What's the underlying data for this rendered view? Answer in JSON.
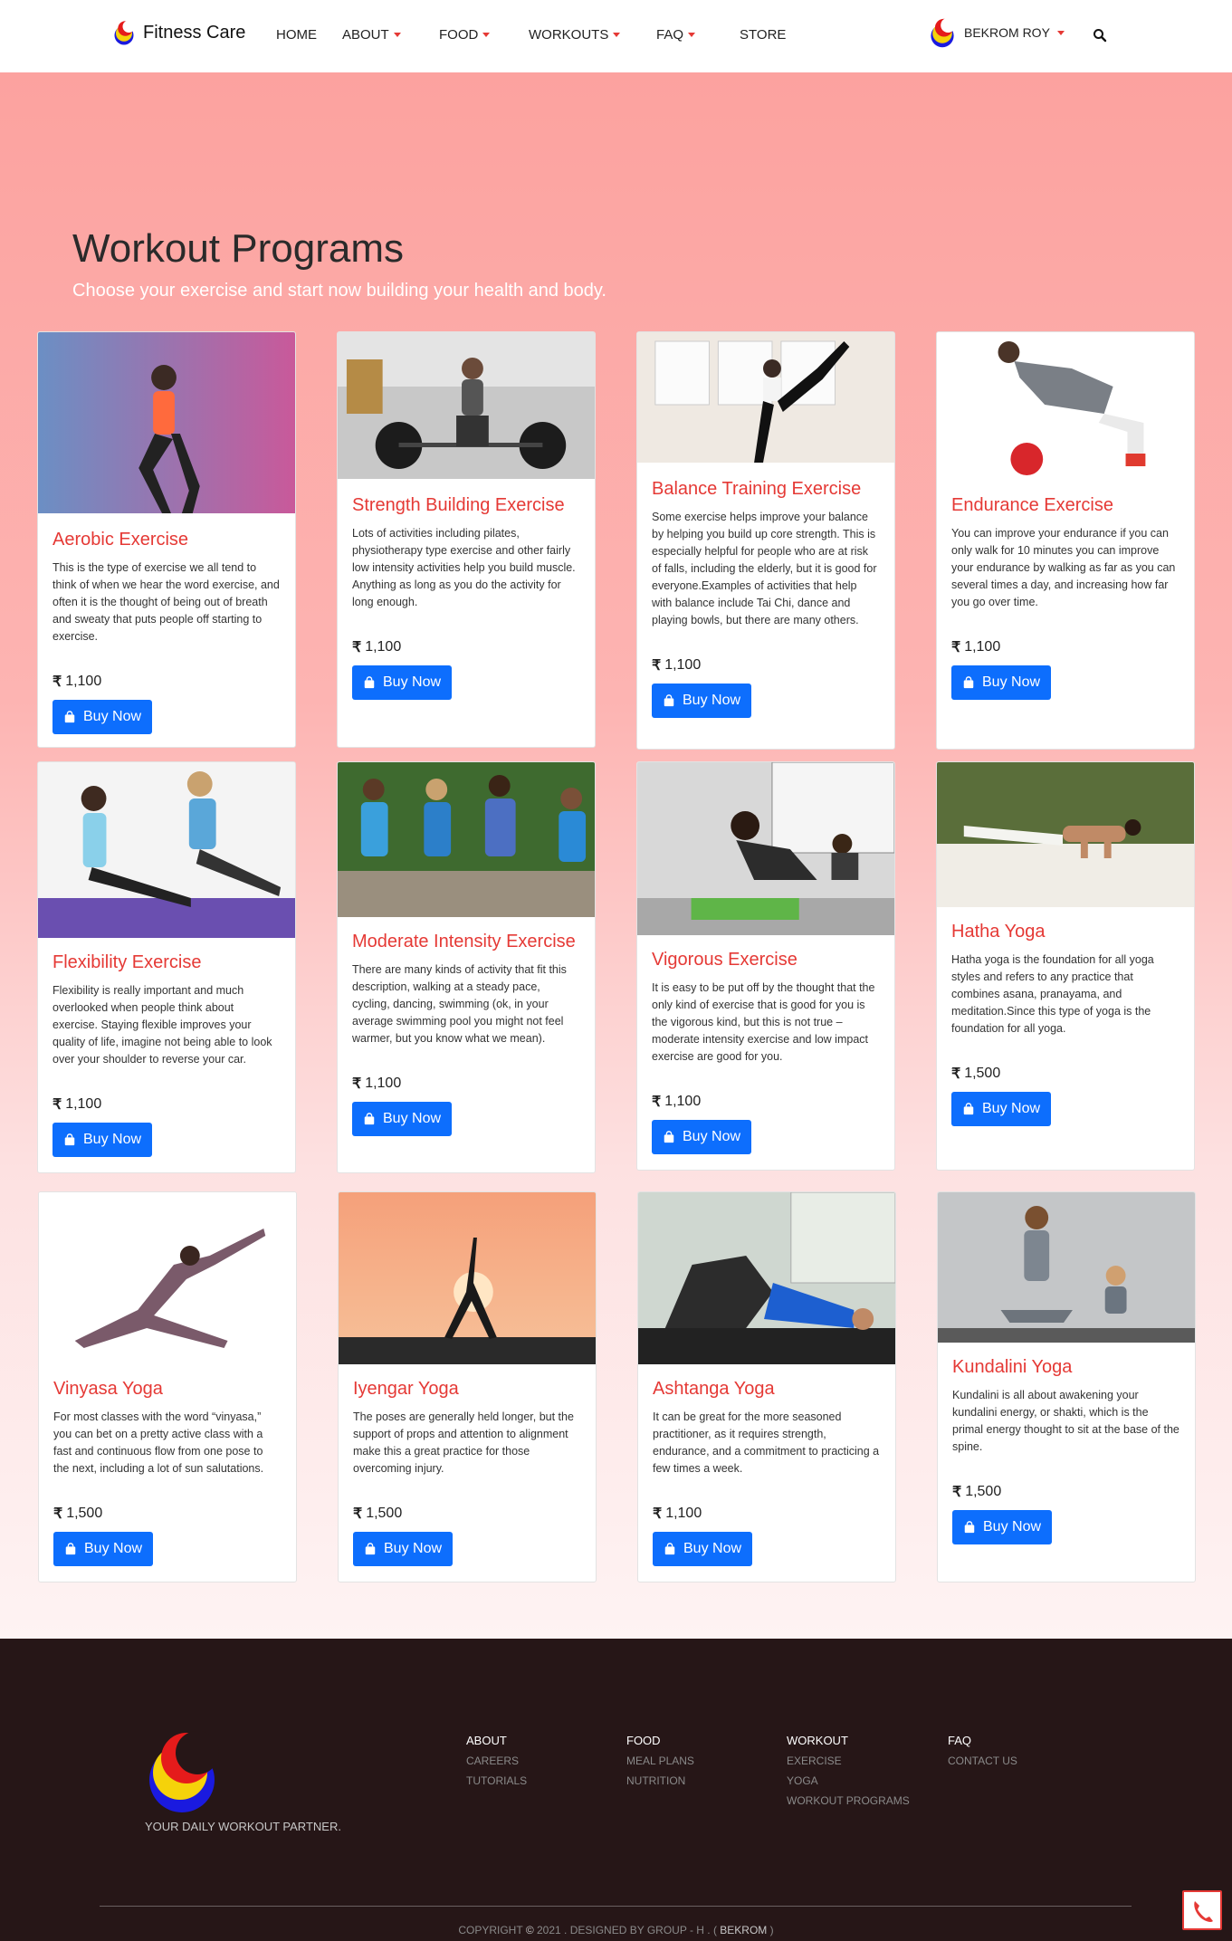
{
  "brand": {
    "name": "Fitness Care"
  },
  "nav": {
    "home": "HOME",
    "about": "ABOUT",
    "food": "FOOD",
    "workouts": "WORKOUTS",
    "faq": "FAQ",
    "store": "STORE",
    "user": "BEKROM ROY"
  },
  "hero": {
    "title": "Workout Programs",
    "subtitle": "Choose your exercise and start now building your health and body."
  },
  "currency": "₹",
  "buy_label": "Buy Now",
  "cards": [
    {
      "title": "Aerobic Exercise",
      "text": "This is the type of exercise we all tend to think of when we hear the word exercise, and often it is the thought of being out of breath and sweaty that puts people off starting to exercise.",
      "price": "1,100",
      "image": "woman-aerobics-photo"
    },
    {
      "title": "Strength Building Exercise",
      "text": "Lots of activities including pilates, physiotherapy type exercise and other fairly low intensity activities help you build muscle. Anything as long as you do the activity for long enough.",
      "price": "1,100",
      "image": "woman-barbell-photo"
    },
    {
      "title": "Balance Training Exercise",
      "text": "Some exercise helps improve your balance by helping you build up core strength. This is especially helpful for people who are at risk of falls, including the elderly, but it is good for everyone.Examples of activities that help with balance include Tai Chi, dance and playing bowls, but there are many others.",
      "price": "1,100",
      "image": "woman-balance-pose-photo"
    },
    {
      "title": "Endurance Exercise",
      "text": "You can improve your endurance if you can only walk for 10 minutes you can improve your endurance by walking as far as you can several times a day, and increasing how far you go over time.",
      "price": "1,100",
      "image": "man-medicine-ball-photo"
    },
    {
      "title": "Flexibility Exercise",
      "text": "Flexibility is really important and much overlooked when people think about exercise. Staying flexible improves your quality of life, imagine not being able to look over your shoulder to reverse your car.",
      "price": "1,100",
      "image": "couple-stretching-photo"
    },
    {
      "title": "Moderate Intensity Exercise",
      "text": "There are many kinds of activity that fit this description, walking at a steady pace, cycling, dancing, swimming (ok, in your average swimming pool you might not feel warmer, but you know what we mean).",
      "price": "1,100",
      "image": "group-walking-photo"
    },
    {
      "title": "Vigorous Exercise",
      "text": "It is easy to be put off by the thought that the only kind of exercise that is good for you is the vigorous kind, but this is not true – moderate intensity exercise and low impact exercise are good for you.",
      "price": "1,100",
      "image": "men-pushups-photo"
    },
    {
      "title": "Hatha Yoga",
      "text": "Hatha yoga is the foundation for all yoga styles and refers to any practice that combines asana, pranayama, and meditation.Since this type of yoga is the foundation for all yoga.",
      "price": "1,500",
      "image": "man-arm-balance-photo"
    },
    {
      "title": "Vinyasa Yoga",
      "text": "For most classes with the word “vinyasa,” you can bet on a pretty active class with a fast and continuous flow from one pose to the next, including a lot of sun salutations.",
      "price": "1,500",
      "image": "woman-lunge-pose-photo"
    },
    {
      "title": "Iyengar Yoga",
      "text": "The poses are generally held longer, but the support of props and attention to alignment make this a great practice for those overcoming injury.",
      "price": "1,500",
      "image": "sunset-silhouette-yoga-photo"
    },
    {
      "title": "Ashtanga Yoga",
      "text": "It can be great for the more seasoned practitioner, as it requires strength, endurance, and a commitment to practicing a few times a week.",
      "price": "1,100",
      "image": "man-bridge-pose-photo"
    },
    {
      "title": "Kundalini Yoga",
      "text": "Kundalini is all about awakening your kundalini energy, or shakti, which is the primal energy thought to sit at the base of the spine.",
      "price": "1,500",
      "image": "mother-child-meditation-photo"
    }
  ],
  "footer": {
    "tagline": "YOUR DAILY WORKOUT PARTNER.",
    "columns": [
      {
        "heading": "ABOUT",
        "links": [
          "CAREERS",
          "TUTORIALS"
        ]
      },
      {
        "heading": "FOOD",
        "links": [
          "MEAL PLANS",
          "NUTRITION"
        ]
      },
      {
        "heading": "WORKOUT",
        "links": [
          "EXERCISE",
          "YOGA",
          "WORKOUT PROGRAMS"
        ]
      },
      {
        "heading": "FAQ",
        "links": [
          "CONTACT US"
        ]
      }
    ],
    "copyright_prefix": "COPYRIGHT",
    "copyright_symbol": "©",
    "copyright_mid": "2021 . DESIGNED BY GROUP - H . (",
    "copyright_name": "BEKROM",
    "copyright_end": ")"
  },
  "colors": {
    "accent": "#e53935",
    "button": "#0d6efd",
    "footer_bg": "#261617",
    "hero_top": "#fca29f"
  }
}
